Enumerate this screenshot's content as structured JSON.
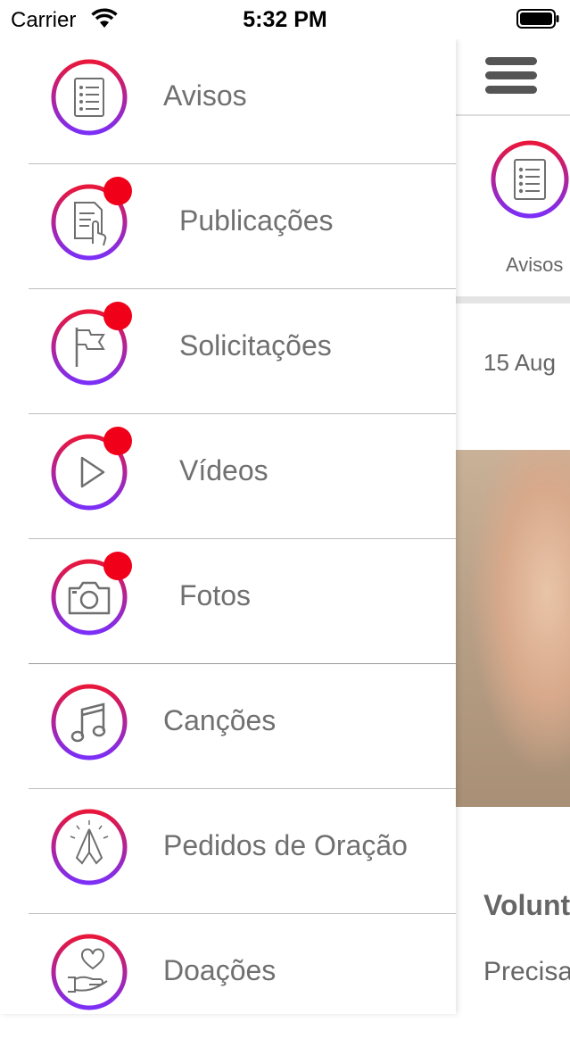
{
  "status_bar": {
    "carrier": "Carrier",
    "time": "5:32 PM"
  },
  "menu": {
    "items": [
      {
        "label": "Avisos",
        "icon": "document-list-icon",
        "badge": false
      },
      {
        "label": "Publicações",
        "icon": "document-hand-icon",
        "badge": true
      },
      {
        "label": "Solicitações",
        "icon": "flag-icon",
        "badge": true
      },
      {
        "label": "Vídeos",
        "icon": "play-icon",
        "badge": true
      },
      {
        "label": "Fotos",
        "icon": "camera-icon",
        "badge": true
      },
      {
        "label": "Canções",
        "icon": "music-note-icon",
        "badge": false
      },
      {
        "label": "Pedidos de Oração",
        "icon": "praying-hands-icon",
        "badge": false
      },
      {
        "label": "Doações",
        "icon": "heart-hand-icon",
        "badge": false
      }
    ]
  },
  "background_page": {
    "tab_label": "Avisos",
    "date": "15 Aug",
    "post_title": "Volunt",
    "post_text": "Precisa ajudar"
  },
  "colors": {
    "ring_start": "#e8173b",
    "ring_end": "#7b2ff7",
    "badge": "#f00019",
    "text": "#707070"
  }
}
